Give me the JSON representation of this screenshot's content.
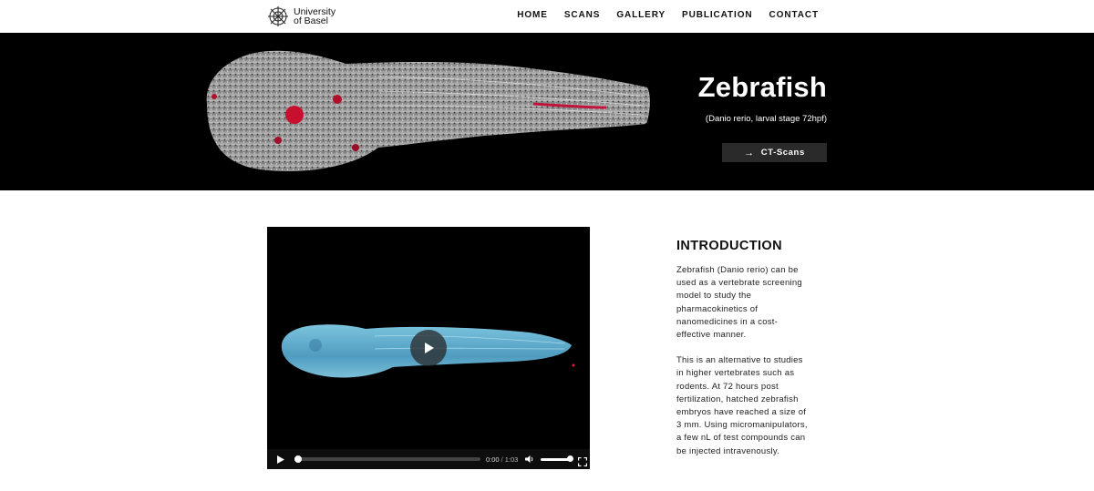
{
  "header": {
    "logo_line1": "University",
    "logo_line2": "of Basel",
    "nav": [
      "HOME",
      "SCANS",
      "GALLERY",
      "PUBLICATION",
      "CONTACT"
    ]
  },
  "hero": {
    "title": "Zebrafish",
    "subtitle": "(Danio rerio, larval stage 72hpf)",
    "button_label": "CT-Scans",
    "button_icon": "arrow-right-icon"
  },
  "video": {
    "current_time": "0:00",
    "separator": "/",
    "duration": "1:03",
    "progress": 0,
    "volume": 1,
    "accent_color": "#5aa9c9"
  },
  "intro": {
    "heading": "INTRODUCTION",
    "paragraph1": "Zebrafish (Danio rerio) can be used as a vertebrate screening model to study the pharmacokinetics of nanomedicines in a cost-effective manner.",
    "paragraph2": "This is an alternative to studies in higher vertebrates such as rodents. At 72 hours post fertilization, hatched zebrafish embryos have reached a size of 3 mm. Using micromanipulators, a few nL of test compounds can be injected intravenously."
  }
}
